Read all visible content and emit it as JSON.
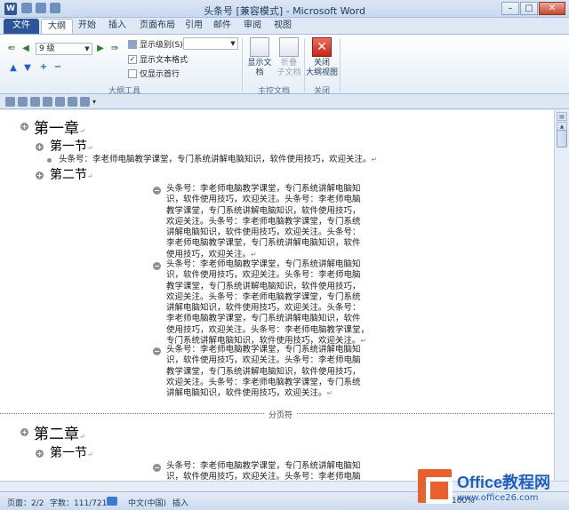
{
  "window": {
    "title": "头条号 [兼容模式] - Microsoft Word",
    "app_icon": "W"
  },
  "tabs": [
    "文件",
    "大纲",
    "开始",
    "插入",
    "页面布局",
    "引用",
    "邮件",
    "审阅",
    "视图"
  ],
  "ribbon": {
    "outline_tools": {
      "label": "大纲工具",
      "level_value": "9 级",
      "show_level_label": "显示级别(S):",
      "show_level_value": "",
      "show_text_format": "显示文本格式",
      "show_first_line": "仅显示首行"
    },
    "master": {
      "label": "主控文档",
      "show_doc": "显示文档",
      "collapse_line1": "折叠",
      "collapse_line2": "子文档"
    },
    "close": {
      "label": "关闭",
      "btn_line1": "关闭",
      "btn_line2": "大纲视图"
    }
  },
  "document": {
    "ch1": "第一章",
    "sec1": "第一节",
    "sec1_body": "头条号：李老师电脑教学课堂，专门系统讲解电脑知识，软件使用技巧，欢迎关注。",
    "sec2": "第二节",
    "block1": [
      "头条号：李老师电脑教学课堂，专门系统讲解电脑知",
      "识，软件使用技巧，欢迎关注。头条号：李老师电脑",
      "教学课堂，专门系统讲解电脑知识，软件使用技巧，",
      "欢迎关注。头条号：李老师电脑教学课堂，专门系统",
      "讲解电脑知识，软件使用技巧，欢迎关注。头条号：",
      "李老师电脑教学课堂，专门系统讲解电脑知识，软件",
      "使用技巧，欢迎关注。"
    ],
    "block2": [
      "头条号：李老师电脑教学课堂，专门系统讲解电脑知",
      "识，软件使用技巧，欢迎关注。头条号：李老师电脑",
      "教学课堂，专门系统讲解电脑知识，软件使用技巧，",
      "欢迎关注。头条号：李老师电脑教学课堂，专门系统",
      "讲解电脑知识，软件使用技巧，欢迎关注。头条号：",
      "李老师电脑教学课堂，专门系统讲解电脑知识，软件",
      "使用技巧，欢迎关注。头条号：李老师电脑教学课堂，",
      "专门系统讲解电脑知识，软件使用技巧，欢迎关注。"
    ],
    "block3": [
      "头条号：李老师电脑教学课堂，专门系统讲解电脑知",
      "识，软件使用技巧，欢迎关注。头条号：李老师电脑",
      "教学课堂，专门系统讲解电脑知识，软件使用技巧，",
      "欢迎关注。头条号：李老师电脑教学课堂，专门系统",
      "讲解电脑知识，软件使用技巧，欢迎关注。"
    ],
    "page_break": "分页符",
    "ch2": "第二章",
    "sec3": "第一节",
    "block4": [
      "头条号：李老师电脑教学课堂，专门系统讲解电脑知",
      "识，软件使用技巧，欢迎关注。头条号：李老师电脑"
    ]
  },
  "status": {
    "page": "页面：2/2",
    "words": "字数：111/721",
    "lang": "中文(中国)",
    "mode": "插入",
    "zoom": "100%"
  },
  "watermark": {
    "line1": "Office教程网",
    "line2": "www.office26.com"
  }
}
